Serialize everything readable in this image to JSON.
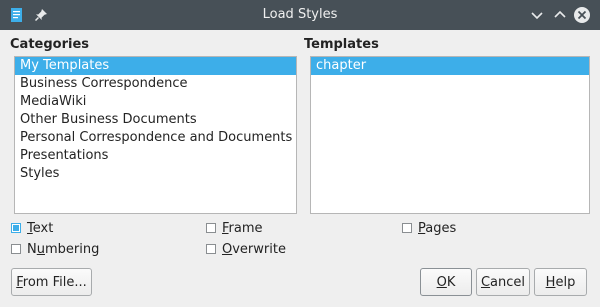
{
  "window": {
    "title": "Load Styles"
  },
  "categories": {
    "label": "Categories",
    "items": [
      "My Templates",
      "Business Correspondence",
      "MediaWiki",
      "Other Business Documents",
      "Personal Correspondence and Documents",
      "Presentations",
      "Styles"
    ],
    "selected_index": 0
  },
  "templates": {
    "label": "Templates",
    "items": [
      "chapter"
    ],
    "selected_index": 0
  },
  "options": {
    "text": {
      "prefix": "",
      "mnemonic": "T",
      "rest": "ext",
      "checked": true
    },
    "frame": {
      "prefix": "",
      "mnemonic": "F",
      "rest": "rame",
      "checked": false
    },
    "pages": {
      "prefix": "",
      "mnemonic": "P",
      "rest": "ages",
      "checked": false
    },
    "numbering": {
      "prefix": "N",
      "mnemonic": "u",
      "rest": "mbering",
      "checked": false
    },
    "overwrite": {
      "prefix": "",
      "mnemonic": "O",
      "rest": "verwrite",
      "checked": false
    }
  },
  "buttons": {
    "from_file": {
      "mnemonic": "F",
      "rest": "rom File..."
    },
    "ok": {
      "mnemonic": "O",
      "rest": "K"
    },
    "cancel": {
      "mnemonic": "C",
      "rest": "ancel"
    },
    "help": {
      "mnemonic": "H",
      "rest": "elp"
    }
  },
  "colors": {
    "accent": "#3daee9",
    "titlebar": "#475057",
    "background": "#efefef"
  }
}
